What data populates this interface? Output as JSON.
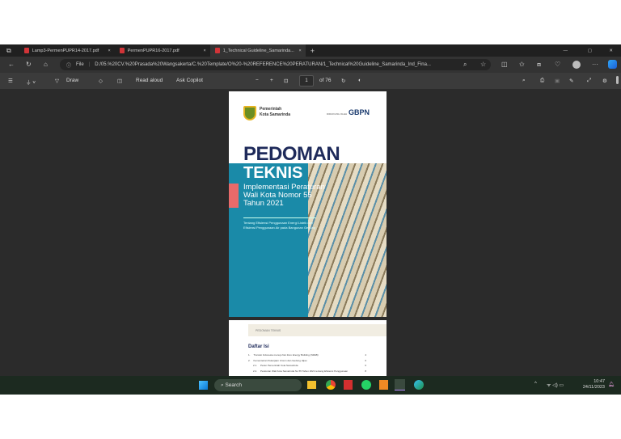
{
  "tabs": [
    {
      "label": "Lamp3-PermenPUPR14-2017.pdf"
    },
    {
      "label": "PermenPUPR16-2017.pdf"
    },
    {
      "label": "1_Technical Guideline_Samarinda..."
    }
  ],
  "address": {
    "prefix": "File",
    "url": "D:/05.%20CV.%20Prasada%20Wangsakerta/C.%20Template/O%20-%20REFERENCE%20PERATURAN/1_Technical%20Guideline_Samarinda_Ind_Fina..."
  },
  "pdf_toolbar": {
    "draw": "Draw",
    "read_aloud": "Read aloud",
    "ask_copilot": "Ask Copilot",
    "page": "1",
    "of": "of 76"
  },
  "cover": {
    "org_line1": "Pemerintah",
    "org_line2": "Kota Samarinda",
    "supported": "DIDUKUNG OLEH",
    "partner": "GBPN",
    "title1": "PEDOMAN",
    "title2": "TEKNIS",
    "subtitle1": "Implementasi Peraturan",
    "subtitle2": "Wali Kota Nomor 55",
    "subtitle3": "Tahun 2021",
    "desc": "Tentang Efisiensi Penggunaan Energi Listrik dan Efisiensi Penggunaan Air pada Bangunan Gedung"
  },
  "page2": {
    "header": "PEDOMAN TEKNIS",
    "toc_title": "Daftar Isi",
    "toc": [
      {
        "n": "1.",
        "t": "Transisi Indonesia menuju Net Zero Energy Building (NZEB)",
        "p": "4"
      },
      {
        "n": "2.",
        "t": "Kementerian Pekerjaan Umum dan Gedung Hijau",
        "p": "6"
      },
      {
        "n": "2.1.",
        "t": "Peran Pemerintah Kota Samarinda",
        "p": "6"
      },
      {
        "n": "2.2.",
        "t": "Peraturan Wali Kota Samarinda No 55 Tahun 2021 tentang Efisiensi Penggunaan",
        "p": "8"
      }
    ]
  },
  "taskbar": {
    "search": "Search",
    "time": "10:47",
    "date": "24/11/2023"
  }
}
